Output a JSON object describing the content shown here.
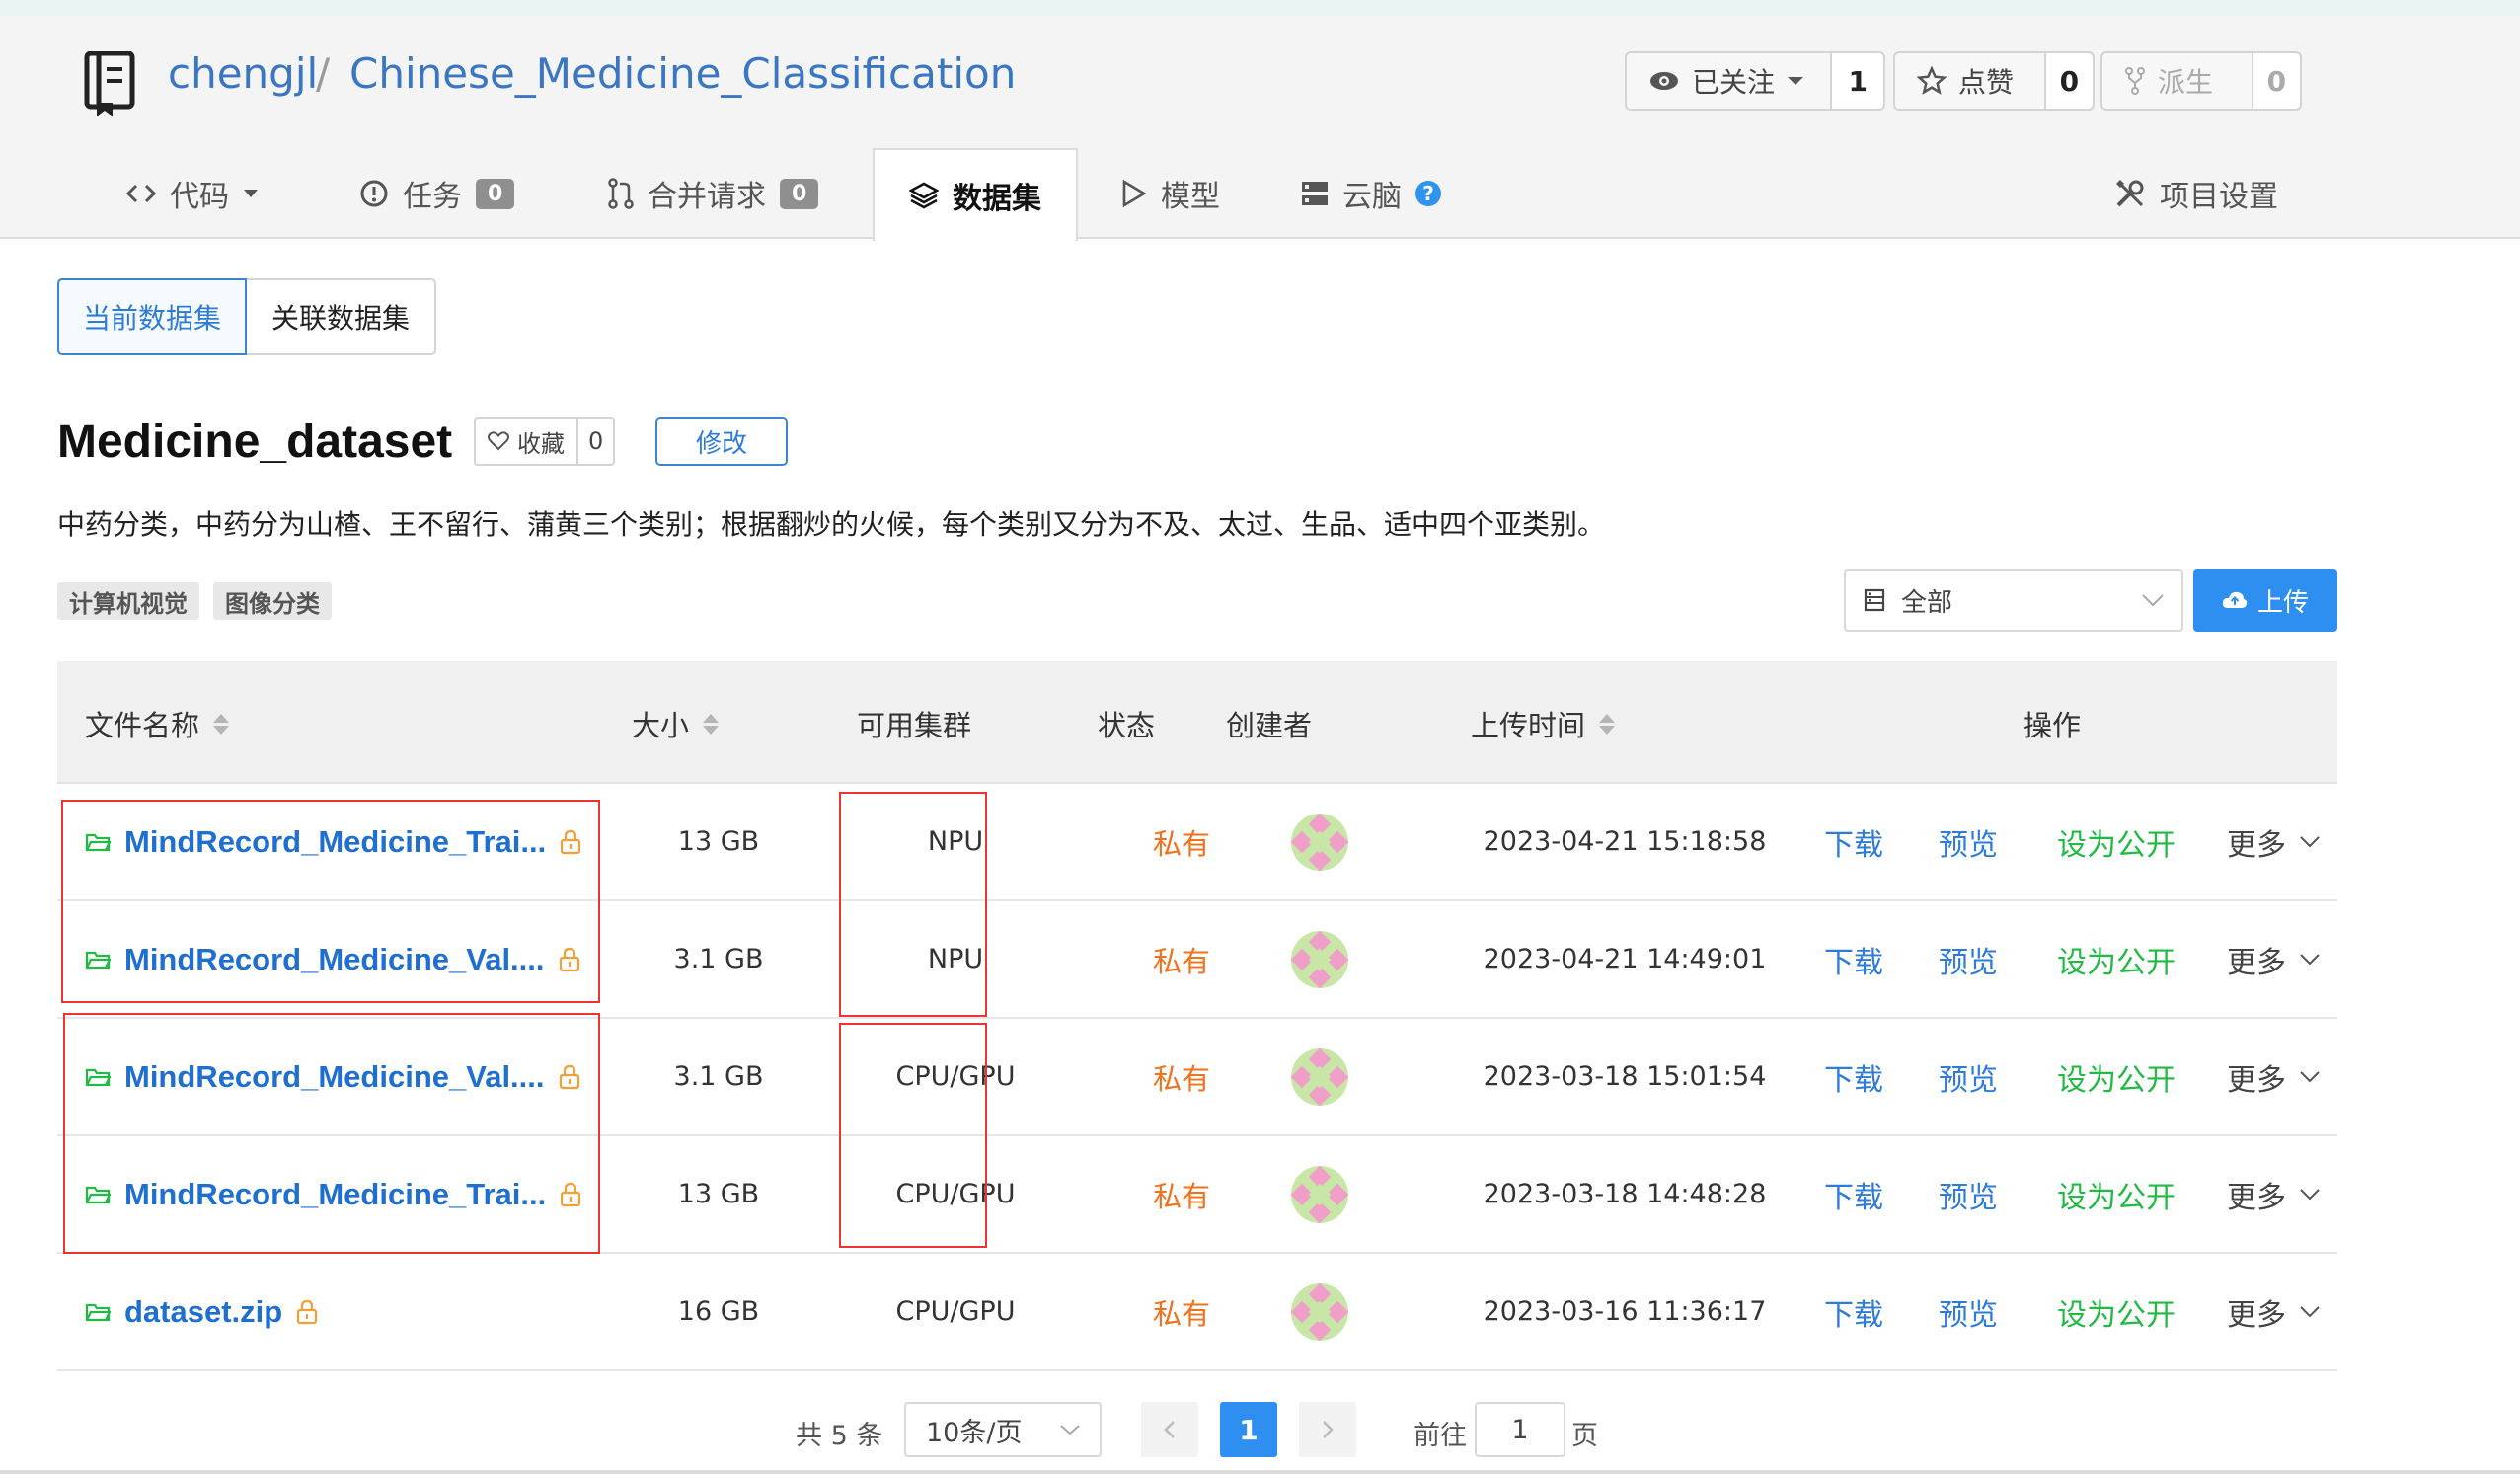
{
  "repo": {
    "owner": "chengjl",
    "separator": "/",
    "name": "Chinese_Medicine_Classification",
    "watch": {
      "label": "已关注",
      "count": "1"
    },
    "star": {
      "label": "点赞",
      "count": "0"
    },
    "fork": {
      "label": "派生",
      "count": "0"
    }
  },
  "tabs": {
    "code": {
      "label": "代码"
    },
    "issues": {
      "label": "任务",
      "badge": "0"
    },
    "pulls": {
      "label": "合并请求",
      "badge": "0"
    },
    "datasets": {
      "label": "数据集"
    },
    "models": {
      "label": "模型"
    },
    "cloudbrain": {
      "label": "云脑",
      "help": "?"
    },
    "settings": {
      "label": "项目设置"
    }
  },
  "subtabs": {
    "current": "当前数据集",
    "linked": "关联数据集"
  },
  "dataset": {
    "title": "Medicine_dataset",
    "fav_label": "收藏",
    "fav_count": "0",
    "edit_label": "修改",
    "description": "中药分类，中药分为山楂、王不留行、蒲黄三个类别；根据翻炒的火候，每个类别又分为不及、太过、生品、适中四个亚类别。",
    "tags": [
      "计算机视觉",
      "图像分类"
    ],
    "filter": "全部",
    "upload": "上传"
  },
  "table": {
    "headers": {
      "name": "文件名称",
      "size": "大小",
      "cluster": "可用集群",
      "status": "状态",
      "creator": "创建者",
      "time": "上传时间",
      "ops": "操作"
    },
    "rows": [
      {
        "name": "MindRecord_Medicine_Trai...",
        "size": "13 GB",
        "cluster": "NPU",
        "status": "私有",
        "time": "2023-04-21 15:18:58",
        "download": "下载",
        "preview": "预览",
        "public": "设为公开",
        "more": "更多"
      },
      {
        "name": "MindRecord_Medicine_Val....",
        "size": "3.1 GB",
        "cluster": "NPU",
        "status": "私有",
        "time": "2023-04-21 14:49:01",
        "download": "下载",
        "preview": "预览",
        "public": "设为公开",
        "more": "更多"
      },
      {
        "name": "MindRecord_Medicine_Val....",
        "size": "3.1 GB",
        "cluster": "CPU/GPU",
        "status": "私有",
        "time": "2023-03-18 15:01:54",
        "download": "下载",
        "preview": "预览",
        "public": "设为公开",
        "more": "更多"
      },
      {
        "name": "MindRecord_Medicine_Trai...",
        "size": "13 GB",
        "cluster": "CPU/GPU",
        "status": "私有",
        "time": "2023-03-18 14:48:28",
        "download": "下载",
        "preview": "预览",
        "public": "设为公开",
        "more": "更多"
      },
      {
        "name": "dataset.zip",
        "size": "16 GB",
        "cluster": "CPU/GPU",
        "status": "私有",
        "time": "2023-03-16 11:36:17",
        "download": "下载",
        "preview": "预览",
        "public": "设为公开",
        "more": "更多"
      }
    ]
  },
  "pagination": {
    "total": "共 5 条",
    "page_size": "10条/页",
    "current": "1",
    "goto_label": "前往",
    "goto_value": "1",
    "page_suffix": "页"
  },
  "colors": {
    "primary": "#2f8ff0",
    "link": "#1f6fd1",
    "private": "#f2711c",
    "public": "#21ba45",
    "highlight": "#ee3333"
  }
}
